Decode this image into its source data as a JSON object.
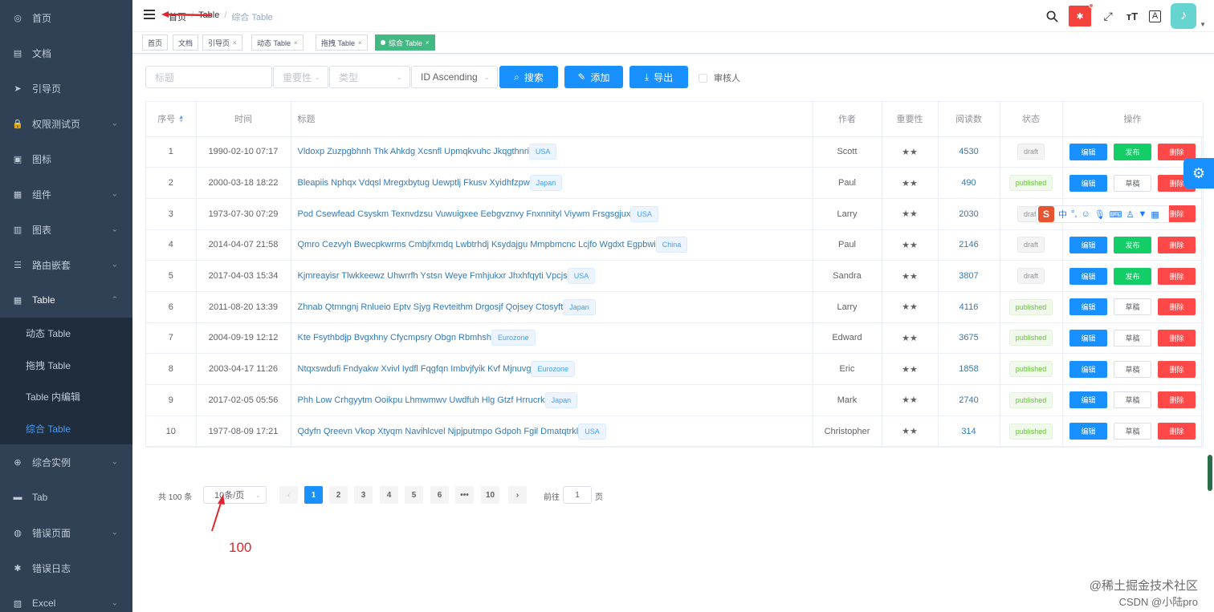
{
  "sidebar": {
    "items": [
      {
        "label": "首页",
        "icon": "dashboard-icon",
        "glyph": "◎",
        "arrow": false
      },
      {
        "label": "文档",
        "icon": "document-icon",
        "glyph": "▤",
        "arrow": false
      },
      {
        "label": "引导页",
        "icon": "guide-icon",
        "glyph": "➤",
        "arrow": false
      },
      {
        "label": "权限测试页",
        "icon": "lock-icon",
        "glyph": "🔒",
        "arrow": true
      },
      {
        "label": "图标",
        "icon": "icon-icon",
        "glyph": "▣",
        "arrow": false
      },
      {
        "label": "组件",
        "icon": "component-icon",
        "glyph": "▦",
        "arrow": true
      },
      {
        "label": "图表",
        "icon": "chart-icon",
        "glyph": "▥",
        "arrow": true
      },
      {
        "label": "路由嵌套",
        "icon": "nested-icon",
        "glyph": "☰",
        "arrow": true
      },
      {
        "label": "Table",
        "icon": "table-icon",
        "glyph": "▦",
        "arrow": true
      }
    ],
    "table_submenu": [
      "动态 Table",
      "拖拽 Table",
      "Table 内编辑",
      "综合 Table"
    ],
    "items_after": [
      {
        "label": "综合实例",
        "icon": "example-icon",
        "glyph": "⊕",
        "arrow": true
      },
      {
        "label": "Tab",
        "icon": "tab-icon",
        "glyph": "▬",
        "arrow": false
      },
      {
        "label": "错误页面",
        "icon": "error-icon",
        "glyph": "◍",
        "arrow": true
      },
      {
        "label": "错误日志",
        "icon": "bug-icon",
        "glyph": "✱",
        "arrow": false
      },
      {
        "label": "Excel",
        "icon": "excel-icon",
        "glyph": "▧",
        "arrow": true
      }
    ]
  },
  "breadcrumb": [
    "首页",
    "Table",
    "综合 Table"
  ],
  "tags": [
    {
      "label": "首页",
      "closable": false
    },
    {
      "label": "文档",
      "closable": false
    },
    {
      "label": "引导页",
      "closable": true
    },
    {
      "label": "动态 Table",
      "closable": true
    },
    {
      "label": "拖拽 Table",
      "closable": true
    },
    {
      "label": "综合 Table",
      "closable": true,
      "active": true
    }
  ],
  "filter": {
    "title_placeholder": "标题",
    "importance_placeholder": "重要性",
    "type_placeholder": "类型",
    "sort_value": "ID Ascending",
    "search_label": "搜索",
    "add_label": "添加",
    "export_label": "导出",
    "reviewer_label": "审核人"
  },
  "table": {
    "columns": [
      "序号",
      "时间",
      "标题",
      "作者",
      "重要性",
      "阅读数",
      "状态",
      "操作"
    ],
    "rows": [
      {
        "id": "1",
        "time": "1990-02-10 07:17",
        "title": "Vldoxp Zuzpgbhnh Thk Ahkdg Xcsnfl Upmqkvuhc Jkqgthnri",
        "tag": "USA",
        "author": "Scott",
        "stars": "★★",
        "reads": "4530",
        "status": "draft"
      },
      {
        "id": "2",
        "time": "2000-03-18 18:22",
        "title": "Bleapiis Nphqx Vdqsl Mregxbytug Uewptlj Fkusv Xyidhfzpw",
        "tag": "Japan",
        "author": "Paul",
        "stars": "★★",
        "reads": "490",
        "status": "published"
      },
      {
        "id": "3",
        "time": "1973-07-30 07:29",
        "title": "Pod Csewfead Csyskm Texnvdzsu Vuwuigxee Eebgvznvy Fnxnnityl Viywm Frsgsgjux",
        "tag": "USA",
        "author": "Larry",
        "stars": "★★",
        "reads": "2030",
        "status": "draft"
      },
      {
        "id": "4",
        "time": "2014-04-07 21:58",
        "title": "Qmro Cezvyh Bwecpkwrms Cmbjfxmdq Lwbtrhdj Ksydajgu Mmpbmcnc Lcjfo Wgdxt Egpbwi",
        "tag": "China",
        "author": "Paul",
        "stars": "★★",
        "reads": "2146",
        "status": "draft"
      },
      {
        "id": "5",
        "time": "2017-04-03 15:34",
        "title": "Kjmreayisr Tlwkkeewz Uhwrrfh Ystsn Weye Fmhjukxr Jhxhfqyti Vpcjs",
        "tag": "USA",
        "author": "Sandra",
        "stars": "★★",
        "reads": "3807",
        "status": "draft"
      },
      {
        "id": "6",
        "time": "2011-08-20 13:39",
        "title": "Zhnab Qtmngnj Rnlueio Eptv Sjyg Revteithm Drgosjf Qojsey Ctosyft",
        "tag": "Japan",
        "author": "Larry",
        "stars": "★★",
        "reads": "4116",
        "status": "published"
      },
      {
        "id": "7",
        "time": "2004-09-19 12:12",
        "title": "Kte Fsythbdjp Bvgxhny Cfycmpsry Obgn Rbmhsh",
        "tag": "Eurozone",
        "author": "Edward",
        "stars": "★★",
        "reads": "3675",
        "status": "published"
      },
      {
        "id": "8",
        "time": "2003-04-17 11:26",
        "title": "Ntqxswdufi Fndyakw Xvivl Iydfl Fqgfqn Imbvjfyik Kvf Mjnuvg",
        "tag": "Eurozone",
        "author": "Eric",
        "stars": "★★",
        "reads": "1858",
        "status": "published"
      },
      {
        "id": "9",
        "time": "2017-02-05 05:56",
        "title": "Phh Low Crhgyytm Ooikpu Lhmwmwv Uwdfuh Hlg Gtzf Hrrucrk",
        "tag": "Japan",
        "author": "Mark",
        "stars": "★★",
        "reads": "2740",
        "status": "published"
      },
      {
        "id": "10",
        "time": "1977-08-09 17:21",
        "title": "Qdyfn Qreevn Vkop Xtyqm Navihlcvel Njpjputmpo Gdpoh Fgil Dmatqtrkl",
        "tag": "USA",
        "author": "Christopher",
        "stars": "★★",
        "reads": "314",
        "status": "published"
      }
    ],
    "edit_label": "编辑",
    "publish_label": "发布",
    "draft_label": "草稿",
    "delete_label": "删除"
  },
  "pagination": {
    "total_text": "共 100 条",
    "page_size": "10条/页",
    "pages": [
      "1",
      "2",
      "3",
      "4",
      "5",
      "6",
      "•••",
      "10"
    ],
    "current": "1",
    "goto_label": "前往",
    "goto_value": "1",
    "page_suffix": "页"
  },
  "annotation": "100",
  "ime_bar": {
    "logo": "S",
    "lang": "中"
  },
  "watermark": {
    "line1": "@稀土掘金技术社区",
    "line2": "CSDN @小陆pro"
  },
  "colors": {
    "sidebar_bg": "#304156",
    "primary": "#1890ff",
    "active_tag": "#42b983",
    "danger": "#ff4949",
    "success": "#13ce66"
  }
}
